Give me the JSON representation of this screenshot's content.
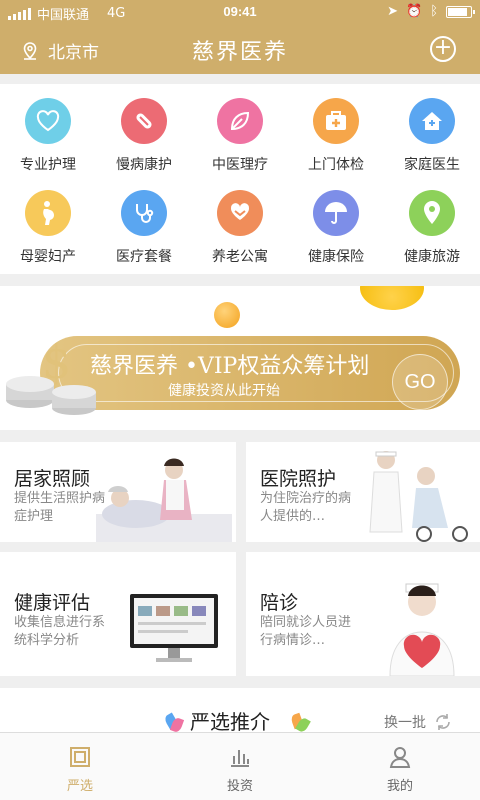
{
  "status": {
    "carrier": "中国联通",
    "network": "4G",
    "time": "09:41"
  },
  "header": {
    "location": "北京市",
    "title": "慈界医养"
  },
  "services": [
    {
      "label": "专业护理",
      "color": "#6fcfe8",
      "icon": "heart-icon"
    },
    {
      "label": "慢病康护",
      "color": "#ec6b74",
      "icon": "pill-icon"
    },
    {
      "label": "中医理疗",
      "color": "#ef73a2",
      "icon": "leaf-icon"
    },
    {
      "label": "上门体检",
      "color": "#f6a64a",
      "icon": "medkit-icon"
    },
    {
      "label": "家庭医生",
      "color": "#5aa6f1",
      "icon": "home-icon"
    },
    {
      "label": "母婴妇产",
      "color": "#f7c95a",
      "icon": "pregnant-icon"
    },
    {
      "label": "医疗套餐",
      "color": "#5aa6f1",
      "icon": "stethoscope-icon"
    },
    {
      "label": "养老公寓",
      "color": "#f08d5a",
      "icon": "heart-hands-icon"
    },
    {
      "label": "健康保险",
      "color": "#7d8ee8",
      "icon": "umbrella-icon"
    },
    {
      "label": "健康旅游",
      "color": "#8dd15a",
      "icon": "map-pin-icon"
    }
  ],
  "banner": {
    "title": "慈界医养 •VIP权益众筹计划",
    "subtitle": "健康投资从此开始",
    "go": "GO"
  },
  "cards": [
    {
      "title": "居家照顾",
      "desc": "提供生活照护病症护理"
    },
    {
      "title": "医院照护",
      "desc": "为住院治疗的病人提供的…"
    },
    {
      "title": "健康评估",
      "desc": "收集信息进行系统科学分析"
    },
    {
      "title": "陪诊",
      "desc": "陪同就诊人员进行病情诊…"
    }
  ],
  "recommend": {
    "title": "严选推介",
    "refresh": "换一批"
  },
  "tabs": [
    {
      "label": "严选",
      "active": true
    },
    {
      "label": "投资",
      "active": false
    },
    {
      "label": "我的",
      "active": false
    }
  ]
}
